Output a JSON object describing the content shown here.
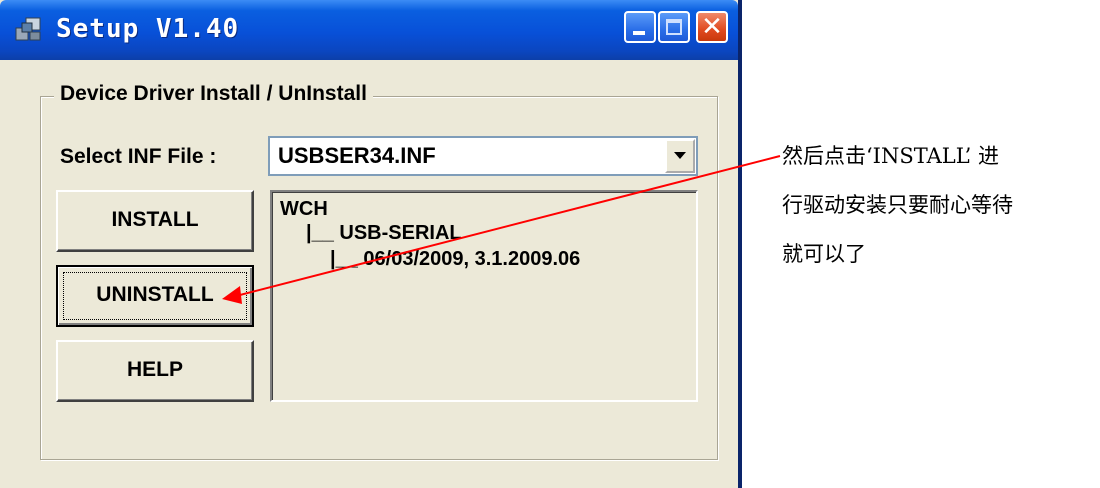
{
  "window": {
    "title": "Setup V1.40",
    "controls": [
      "minimize-icon",
      "maximize-icon",
      "close-icon"
    ],
    "titlebar_color": "#0a5fe0",
    "face_color": "#ece9d8"
  },
  "group": {
    "label": "Device Driver Install / UnInstall"
  },
  "inf_select": {
    "label": "Select INF File :",
    "value": "USBSER34.INF"
  },
  "buttons": {
    "install": "INSTALL",
    "uninstall": "UNINSTALL",
    "help": "HELP"
  },
  "driver_tree": {
    "root": "WCH",
    "child": "|__ USB-SERIAL",
    "grandchild": "|__ 06/03/2009, 3.1.2009.06"
  },
  "annotation": {
    "lines": [
      "然后点击‘INSTALL’ 进",
      "行驱动安装只要耐心等待",
      "就可以了"
    ],
    "arrow_color": "#ff0000"
  }
}
